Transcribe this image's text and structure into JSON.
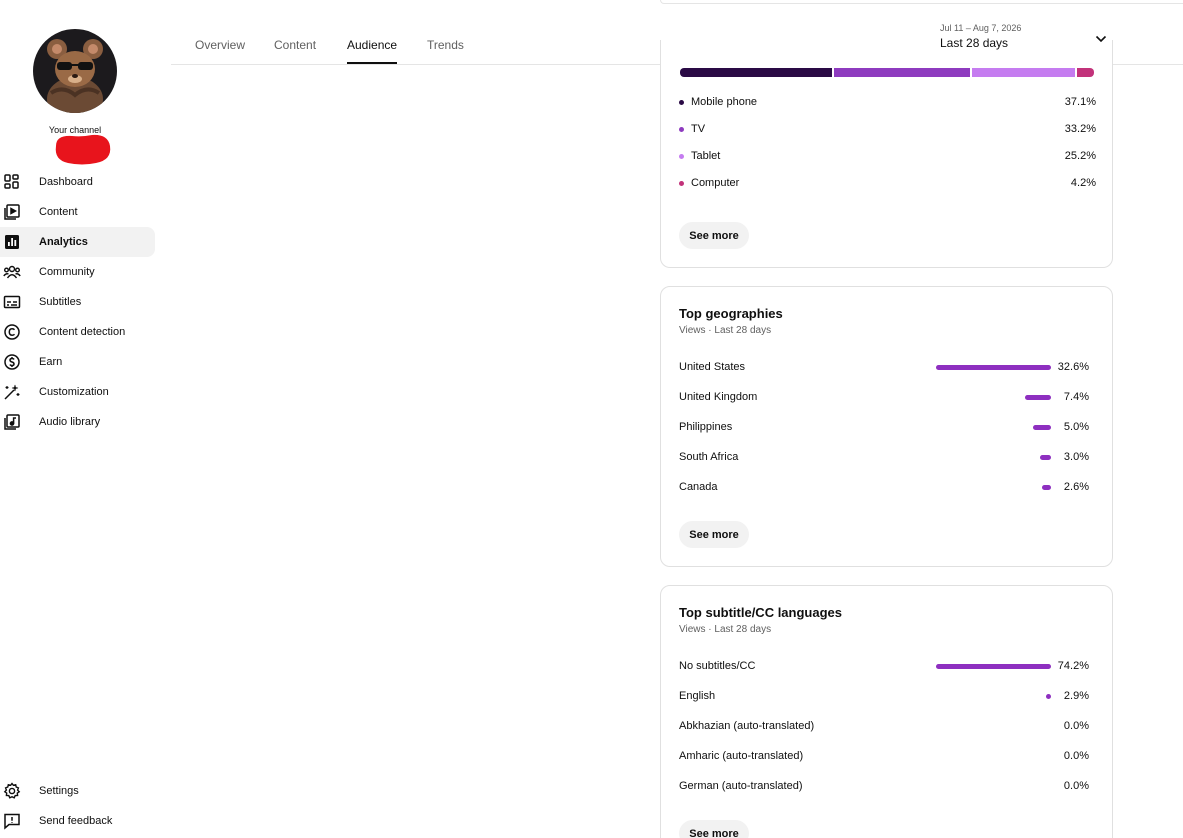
{
  "sidebar": {
    "channel_label": "Your channel",
    "items": [
      {
        "label": "Dashboard",
        "icon": "dashboard-icon"
      },
      {
        "label": "Content",
        "icon": "content-icon"
      },
      {
        "label": "Analytics",
        "icon": "analytics-icon",
        "active": true
      },
      {
        "label": "Community",
        "icon": "community-icon"
      },
      {
        "label": "Subtitles",
        "icon": "subtitles-icon"
      },
      {
        "label": "Content detection",
        "icon": "copyright-icon"
      },
      {
        "label": "Earn",
        "icon": "dollar-icon"
      },
      {
        "label": "Customization",
        "icon": "magic-wand-icon"
      },
      {
        "label": "Audio library",
        "icon": "audio-library-icon"
      }
    ],
    "footer": [
      {
        "label": "Settings",
        "icon": "gear-icon"
      },
      {
        "label": "Send feedback",
        "icon": "feedback-icon"
      }
    ]
  },
  "header": {
    "tabs": [
      {
        "label": "Overview"
      },
      {
        "label": "Content"
      },
      {
        "label": "Audience",
        "active": true
      },
      {
        "label": "Trends"
      }
    ],
    "date_range": "Jul 11 – Aug 7, 2026",
    "date_label": "Last 28 days"
  },
  "devices": {
    "segments": [
      {
        "label": "Mobile phone",
        "value": "37.1%",
        "percent": 37.1,
        "color": "#2a0a45"
      },
      {
        "label": "TV",
        "value": "33.2%",
        "percent": 33.2,
        "color": "#8e3bbf"
      },
      {
        "label": "Tablet",
        "value": "25.2%",
        "percent": 25.2,
        "color": "#c57cf0"
      },
      {
        "label": "Computer",
        "value": "4.2%",
        "percent": 4.2,
        "color": "#c2327a"
      }
    ],
    "see_more": "See more"
  },
  "geographies": {
    "title": "Top geographies",
    "subtitle": "Views · Last 28 days",
    "rows": [
      {
        "label": "United States",
        "value": "32.6%",
        "percent": 32.6
      },
      {
        "label": "United Kingdom",
        "value": "7.4%",
        "percent": 7.4
      },
      {
        "label": "Philippines",
        "value": "5.0%",
        "percent": 5.0
      },
      {
        "label": "South Africa",
        "value": "3.0%",
        "percent": 3.0
      },
      {
        "label": "Canada",
        "value": "2.6%",
        "percent": 2.6
      }
    ],
    "see_more": "See more"
  },
  "languages": {
    "title": "Top subtitle/CC languages",
    "subtitle": "Views · Last 28 days",
    "rows": [
      {
        "label": "No subtitles/CC",
        "value": "74.2%",
        "percent": 74.2
      },
      {
        "label": "English",
        "value": "2.9%",
        "percent": 2.9
      },
      {
        "label": "Abkhazian (auto-translated)",
        "value": "0.0%",
        "percent": 0
      },
      {
        "label": "Amharic (auto-translated)",
        "value": "0.0%",
        "percent": 0
      },
      {
        "label": "German (auto-translated)",
        "value": "0.0%",
        "percent": 0
      }
    ],
    "see_more": "See more"
  },
  "colors": {
    "accent": "#8e2fc0",
    "redaction": "#e8141c"
  }
}
